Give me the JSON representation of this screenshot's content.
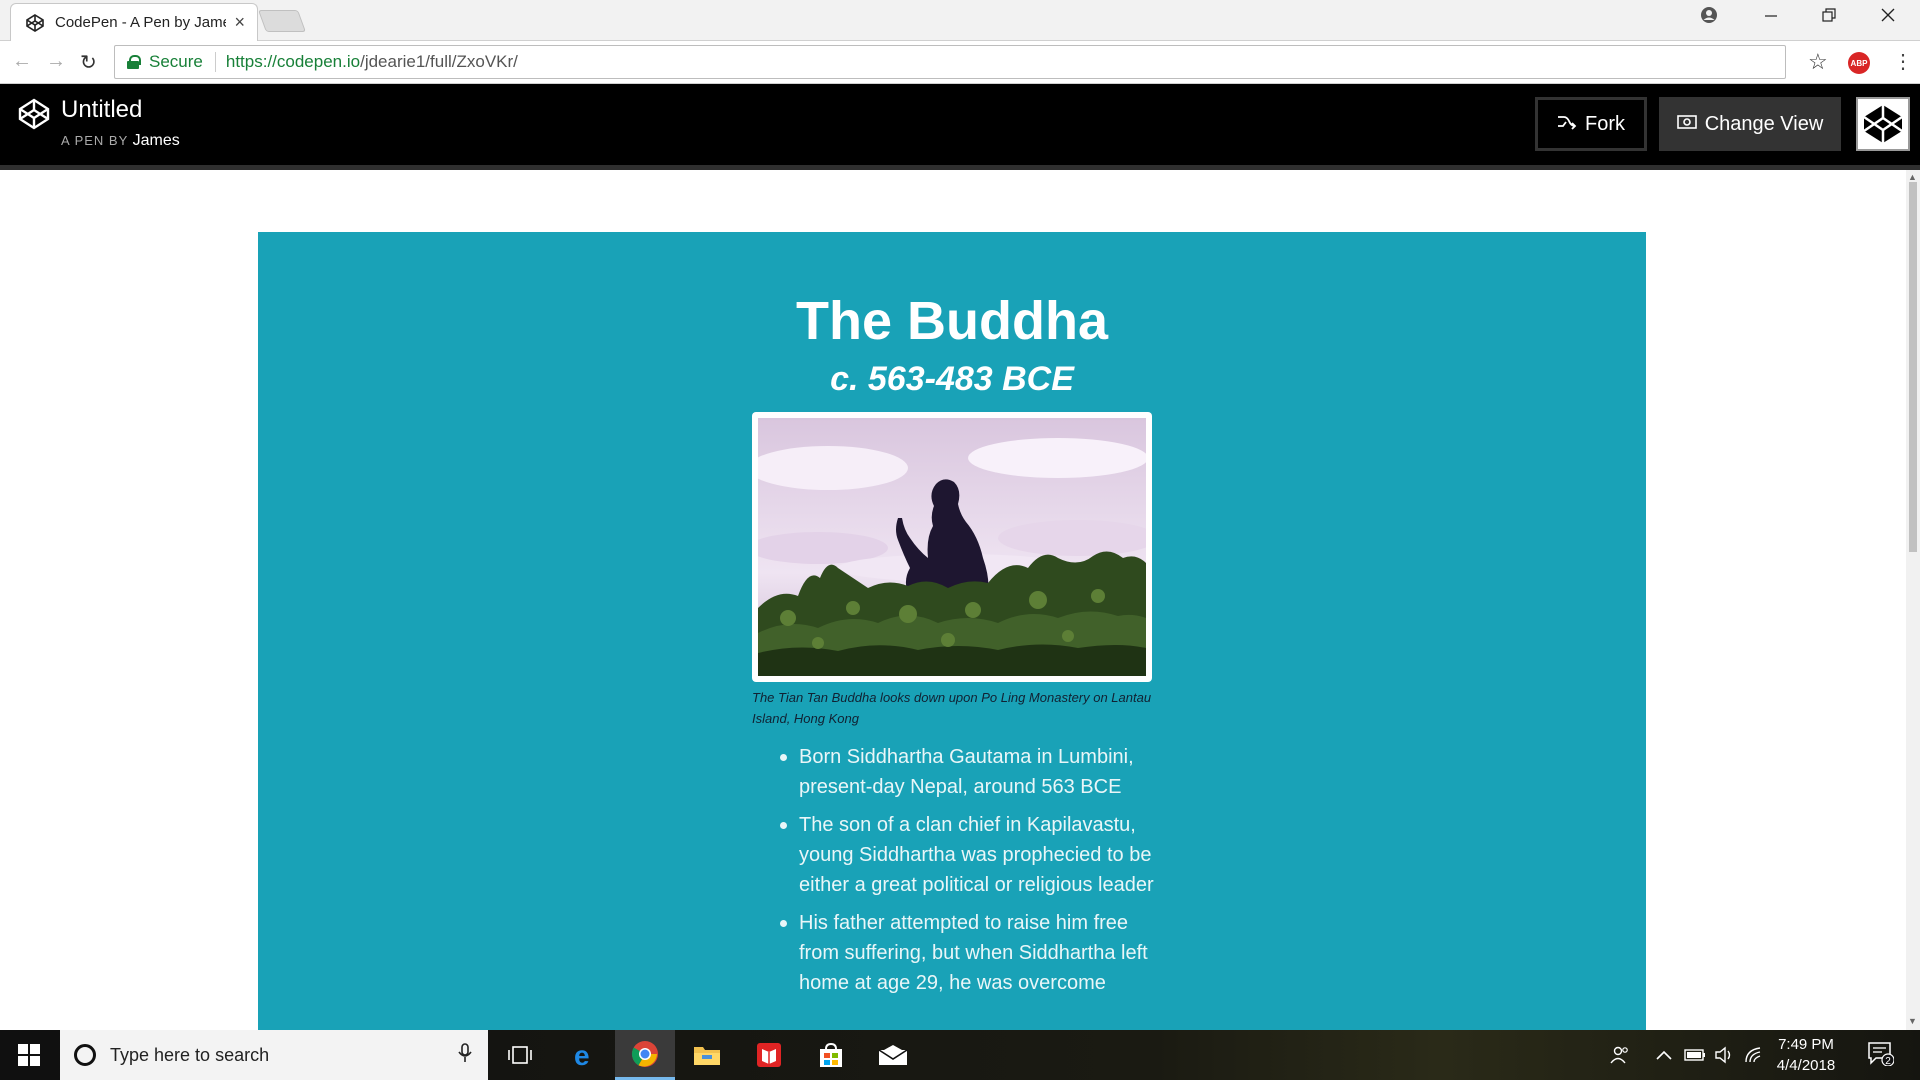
{
  "browser": {
    "tab_title": "CodePen - A Pen by James",
    "tab_close": "×",
    "secure_label": "Secure",
    "url_scheme_host": "https://codepen.io",
    "url_path": "/jdearie1/full/ZxoVKr/",
    "adblock_label": "ABP"
  },
  "codepen": {
    "pen_title": "Untitled",
    "byline": "A PEN BY",
    "author": "James",
    "fork_label": "Fork",
    "change_view_label": "Change View"
  },
  "page": {
    "title": "The Buddha",
    "subtitle": "c. 563-483 BCE",
    "caption": "The Tian Tan Buddha looks down upon Po Ling Monastery on Lantau Island, Hong Kong",
    "facts": [
      "Born Siddhartha Gautama in Lumbini, present-day Nepal, around 563 BCE",
      "The son of a clan chief in Kapilavastu, young Siddhartha was prophecied to be either a great political or religious leader",
      "His father attempted to raise him free from suffering, but when Siddhartha left home at age 29, he was overcome"
    ],
    "accent_color": "#19a2b7"
  },
  "taskbar": {
    "search_placeholder": "Type here to search",
    "time": "7:49 PM",
    "date": "4/4/2018",
    "notification_count": "2"
  }
}
